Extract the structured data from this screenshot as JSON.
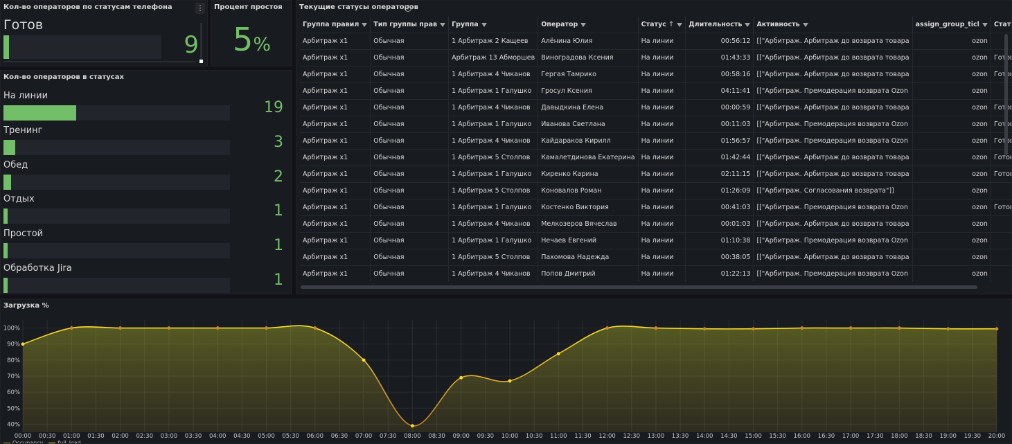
{
  "phone_status_panel": {
    "title": "Кол-во операторов по статусам телефона",
    "menu_icon": "vertical-dots-icon",
    "label": "Готов",
    "value": "9",
    "fill_fraction": 0.035
  },
  "idle_percent_panel": {
    "title": "Процент простоя",
    "value": "5",
    "unit": "%"
  },
  "operators_in_status_panel": {
    "title": "Кол-во операторов в статусах",
    "color": "#73bf69",
    "items": [
      {
        "label": "На линии",
        "value": "19",
        "fraction": 0.075
      },
      {
        "label": "Тренинг",
        "value": "3",
        "fraction": 0.012
      },
      {
        "label": "Обед",
        "value": "2",
        "fraction": 0.008
      },
      {
        "label": "Отдых",
        "value": "1",
        "fraction": 0.004
      },
      {
        "label": "Простой",
        "value": "1",
        "fraction": 0.004
      },
      {
        "label": "Обработка Jira",
        "value": "1",
        "fraction": 0.004
      }
    ]
  },
  "operators_table": {
    "title": "Текущие статусы операторов",
    "info_icon": "info-icon",
    "columns": [
      "Группа правил",
      "Тип группы прав",
      "Группа",
      "Оператор",
      "Статус",
      "Длительность",
      "Активность",
      "assign_group_ticl",
      "Статус теле"
    ],
    "rows": [
      [
        "Арбитраж x1",
        "Обычная",
        "1 Арбитраж 2 Кащеев",
        "Алёнина Юлия",
        "На линии",
        "00:56:12",
        "[[\"Арбитраж. Арбитраж до возврата товара",
        "ozon",
        ""
      ],
      [
        "Арбитраж x1",
        "Обычная",
        "Арбитраж 13 Абморшев",
        "Виноградова Ксения",
        "На линии",
        "01:43:33",
        "[[\"Арбитраж. Арбитраж до возврата товара",
        "ozon",
        "Готов"
      ],
      [
        "Арбитраж x1",
        "Обычная",
        "1 Арбитраж 4 Чиканов",
        "Гергая Тамрико",
        "На линии",
        "00:58:16",
        "[[\"Арбитраж. Арбитраж до возврата товара",
        "ozon",
        "Готов"
      ],
      [
        "Арбитраж x1",
        "Обычная",
        "1 Арбитраж 1 Галушко",
        "Гросул Ксения",
        "На линии",
        "04:11:41",
        "[[\"Арбитраж. Премодерация возврата Ozon",
        "ozon",
        ""
      ],
      [
        "Арбитраж x1",
        "Обычная",
        "1 Арбитраж 4 Чиканов",
        "Давыдкина Елена",
        "На линии",
        "00:00:59",
        "[[\"Арбитраж. Арбитраж до возврата товара",
        "ozon",
        "Готов"
      ],
      [
        "Арбитраж x1",
        "Обычная",
        "1 Арбитраж 1 Галушко",
        "Иванова Светлана",
        "На линии",
        "00:11:03",
        "[[\"Арбитраж. Премодерация возврата Ozon",
        "ozon",
        "Готов"
      ],
      [
        "Арбитраж x1",
        "Обычная",
        "1 Арбитраж 4 Чиканов",
        "Кайдараков Кирилл",
        "На линии",
        "01:56:57",
        "[[\"Арбитраж. Премодерация возврата Ozon",
        "ozon",
        "Готов"
      ],
      [
        "Арбитраж x1",
        "Обычная",
        "1 Арбитраж 5 Столпов",
        "Камалетдинова Екатерина",
        "На линии",
        "01:42:44",
        "[[\"Арбитраж. Арбитраж до возврата товара",
        "ozon",
        "Готов"
      ],
      [
        "Арбитраж x1",
        "Обычная",
        "1 Арбитраж 1 Галушко",
        "Киренко Карина",
        "На линии",
        "02:11:15",
        "[[\"Арбитраж. Арбитраж до возврата товара",
        "ozon",
        "Готов"
      ],
      [
        "Арбитраж x1",
        "Обычная",
        "1 Арбитраж 5 Столпов",
        "Коновалов Роман",
        "На линии",
        "01:26:09",
        "[[\"Арбитраж. Согласования возврата\"]]",
        "ozon",
        ""
      ],
      [
        "Арбитраж x1",
        "Обычная",
        "1 Арбитраж 1 Галушко",
        "Костенко Виктория",
        "На линии",
        "00:41:03",
        "[[\"Арбитраж. Премодерация возврата Ozon",
        "ozon",
        "Готов"
      ],
      [
        "Арбитраж x1",
        "Обычная",
        "1 Арбитраж 4 Чиканов",
        "Мелкозеров Вячеслав",
        "На линии",
        "00:01:03",
        "[[\"Арбитраж. Арбитраж до возврата товара",
        "ozon",
        ""
      ],
      [
        "Арбитраж x1",
        "Обычная",
        "1 Арбитраж 1 Галушко",
        "Нечаев Евгений",
        "На линии",
        "01:10:38",
        "[[\"Арбитраж. Премодерация возврата Ozon",
        "ozon",
        ""
      ],
      [
        "Арбитраж x1",
        "Обычная",
        "1 Арбитраж 5 Столпов",
        "Пахомова Надежда",
        "На линии",
        "00:38:05",
        "[[\"Арбитраж. Арбитраж до возврата товара",
        "ozon",
        ""
      ],
      [
        "Арбитраж x1",
        "Обычная",
        "1 Арбитраж 4 Чиканов",
        "Попов Дмитрий",
        "На линии",
        "01:22:13",
        "[[\"Арбитраж. Премодерация возврата Ozon",
        "ozon",
        ""
      ]
    ]
  },
  "load_panel": {
    "title": "Загрузка %",
    "legend": [
      {
        "name": "Occupancy",
        "color": "#c8a92a"
      },
      {
        "name": "full_load",
        "color": "#fade2a"
      }
    ]
  },
  "chart_data": {
    "type": "line",
    "title": "Загрузка %",
    "y_ticks": [
      "40%",
      "50%",
      "60%",
      "70%",
      "80%",
      "90%",
      "100%"
    ],
    "ylim": [
      35,
      105
    ],
    "x_ticks": [
      "00:00",
      "00:30",
      "01:00",
      "01:30",
      "02:00",
      "02:30",
      "03:00",
      "03:30",
      "04:00",
      "04:30",
      "05:00",
      "05:30",
      "06:00",
      "06:30",
      "07:00",
      "07:30",
      "08:00",
      "08:30",
      "09:00",
      "09:30",
      "10:00",
      "10:30",
      "11:00",
      "11:30",
      "12:00",
      "12:30",
      "13:00",
      "13:30",
      "14:00",
      "14:30",
      "15:00",
      "15:30",
      "16:00",
      "16:30",
      "17:00",
      "17:30",
      "18:00",
      "18:30",
      "19:00",
      "19:30",
      "20:00"
    ],
    "points_x_hours": [
      0,
      1,
      2,
      3,
      4,
      5,
      6,
      7,
      8,
      9,
      10,
      11,
      12,
      13,
      14,
      15,
      16,
      17,
      18,
      19,
      20
    ],
    "series": [
      {
        "name": "Occupancy",
        "color": "#fade2a",
        "values": [
          90,
          100,
          100,
          100,
          100,
          100,
          100,
          80,
          39,
          69,
          67,
          84,
          100,
          100,
          99.5,
          99.5,
          100,
          100,
          100,
          99.5,
          99.5
        ]
      }
    ],
    "grid": true,
    "legend_placement": "bottom-left"
  }
}
